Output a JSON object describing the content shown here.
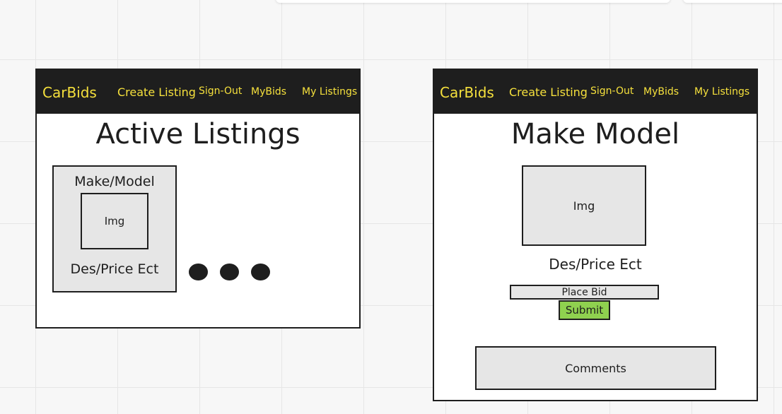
{
  "frames": {
    "listings": {
      "nav": {
        "brand": "CarBids",
        "create_listing": "Create Listing",
        "sign_out": "Sign-Out",
        "my_bids": "MyBids",
        "my_listings": "My Listings"
      },
      "heading": "Active Listings",
      "card": {
        "title": "Make/Model",
        "image_label": "Img",
        "description": "Des/Price Ect"
      }
    },
    "detail": {
      "nav": {
        "brand": "CarBids",
        "create_listing": "Create Listing",
        "sign_out": "Sign-Out",
        "my_bids": "MyBids",
        "my_listings": "My Listings"
      },
      "heading": "Make Model",
      "image_label": "Img",
      "description": "Des/Price Ect",
      "bid_placeholder": "Place Bid",
      "submit_label": "Submit",
      "comments_label": "Comments"
    }
  },
  "colors": {
    "navbar_bg": "#1e1e1e",
    "nav_text": "#f5e03c",
    "placeholder_fill": "#e6e6e6",
    "submit_fill": "#8fd14f"
  }
}
